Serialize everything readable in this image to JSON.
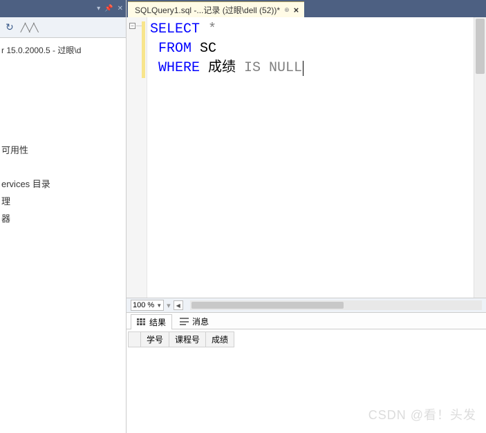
{
  "left_panel": {
    "server_info": "r 15.0.2000.5 - 过眼\\d",
    "tree_items": [
      "可用性",
      "ervices 目录",
      "理",
      "器"
    ]
  },
  "tab": {
    "title": "SQLQuery1.sql -...记录 (过眼\\dell (52))*"
  },
  "editor": {
    "line1_kw": "SELECT",
    "line1_op": " *",
    "line2_kw": "FROM",
    "line2_ident": " SC",
    "line3_kw": "WHERE",
    "line3_ident": " 成绩 ",
    "line3_op": "IS NULL"
  },
  "zoom": {
    "level": "100 %"
  },
  "results": {
    "tab_results": "结果",
    "tab_messages": "消息",
    "columns": [
      "学号",
      "课程号",
      "成绩"
    ]
  },
  "watermark": "CSDN @看！头发"
}
